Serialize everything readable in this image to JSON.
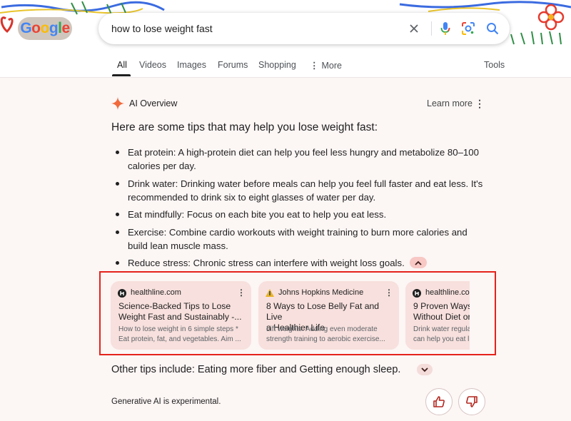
{
  "search": {
    "query": "how to lose weight fast"
  },
  "logo": {
    "text": "Google"
  },
  "tabs": [
    {
      "label": "All",
      "active": true
    },
    {
      "label": "Videos"
    },
    {
      "label": "Images"
    },
    {
      "label": "Forums"
    },
    {
      "label": "Shopping"
    },
    {
      "label": "More",
      "icon": "kebab-icon"
    }
  ],
  "tools_label": "Tools",
  "ai_overview": {
    "title": "AI Overview",
    "learn_more": "Learn more",
    "intro": "Here are some tips that may help you lose weight fast:",
    "tips": [
      "Eat protein: A high-protein diet can help you feel less hungry and metabolize 80–100 calories per day.",
      "Drink water: Drinking water before meals can help you feel full faster and eat less. It's recommended to drink six to eight glasses of water per day.",
      "Eat mindfully: Focus on each bite you eat to help you eat less.",
      "Exercise: Combine cardio workouts with weight training to burn more calories and build lean muscle mass.",
      "Reduce stress: Chronic stress can interfere with weight loss goals."
    ],
    "sources": [
      {
        "site": "healthline.com",
        "title": "Science-Backed Tips to Lose\nWeight Fast and Sustainably -...",
        "snippet": "How to lose weight in 6 simple steps *\nEat protein, fat, and vegetables. Aim ..."
      },
      {
        "site": "Johns Hopkins Medicine",
        "title": "8 Ways to Lose Belly Fat and Live\na Healthier Life",
        "snippet": "Lift weights. Adding even moderate\nstrength training to aerobic exercise..."
      },
      {
        "site": "healthline.com",
        "title": "9 Proven Ways t\nWithout Diet or",
        "snippet": "Drink water regula\ncan help you eat l"
      }
    ],
    "other_tips": "Other tips include: Eating more fiber and Getting enough sleep.",
    "disclaimer": "Generative AI is experimental."
  },
  "colors": {
    "accent_red": "#e5221b",
    "card_bg": "#f7e0dd",
    "panel_bg": "#fcf6f5",
    "mic_blue": "#4285f4",
    "feedback_red": "#b3261e"
  }
}
